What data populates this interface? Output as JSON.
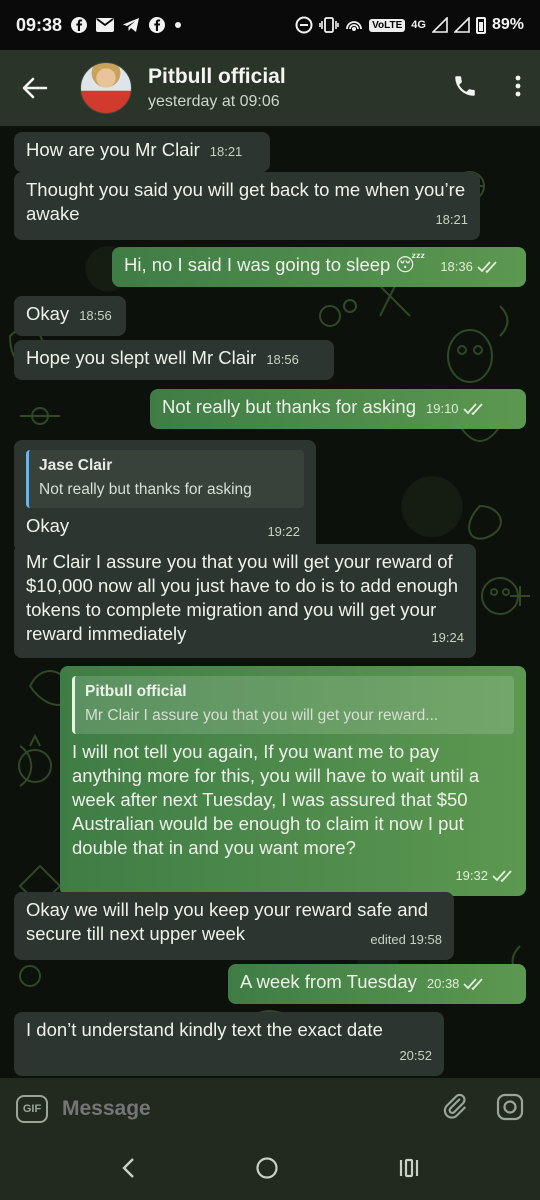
{
  "status": {
    "time": "09:38",
    "network": "4G",
    "volte": "VoLTE",
    "battery": "89%"
  },
  "header": {
    "title": "Pitbull official",
    "subtitle": "yesterday at 09:06"
  },
  "messages": [
    {
      "dir": "in",
      "text": "How  are you Mr Clair",
      "time": "18:21"
    },
    {
      "dir": "in",
      "text": "Thought you said you will get back to me when you’re awake",
      "time": "18:21"
    },
    {
      "dir": "out",
      "text": "Hi, no I said I was going to sleep",
      "emoji": "😴",
      "time": "18:36"
    },
    {
      "dir": "in",
      "text": "Okay",
      "time": "18:56"
    },
    {
      "dir": "in",
      "text": "Hope you slept well Mr Clair",
      "time": "18:56"
    },
    {
      "dir": "out",
      "text": "Not really but thanks for asking",
      "time": "19:10"
    },
    {
      "dir": "in",
      "reply_name": "Jase Clair",
      "reply_text": "Not really but thanks for asking",
      "text": "Okay",
      "time": "19:22"
    },
    {
      "dir": "in",
      "text": "Mr Clair I assure you that you will get your reward of $10,000 now all you just have to do is to add enough tokens to complete migration and you will get your reward immediately",
      "time": "19:24"
    },
    {
      "dir": "out",
      "reply_name": "Pitbull official",
      "reply_text": "Mr Clair I assure you that you will get your reward...",
      "text": "I will not tell you again, If you want me to pay anything more for this, you will have to wait until a week after next Tuesday, I was assured that $50 Australian would be enough to claim it now I put double that in and you want more?",
      "time": "19:32"
    },
    {
      "dir": "in",
      "text": "Okay we will help you keep your reward safe and secure till next upper week",
      "time": "edited 19:58"
    },
    {
      "dir": "out",
      "text": "A week from Tuesday",
      "time": "20:38"
    },
    {
      "dir": "in",
      "text": "I don’t understand kindly text the exact date",
      "time": "20:52"
    }
  ],
  "composer": {
    "gif_label": "GIF",
    "placeholder": "Message"
  },
  "colors": {
    "header_bg": "#2b3429",
    "incoming_bubble": "#2c3530",
    "outgoing_bubble": "#4f8c4b",
    "reply_accent": "#64b5f6"
  }
}
